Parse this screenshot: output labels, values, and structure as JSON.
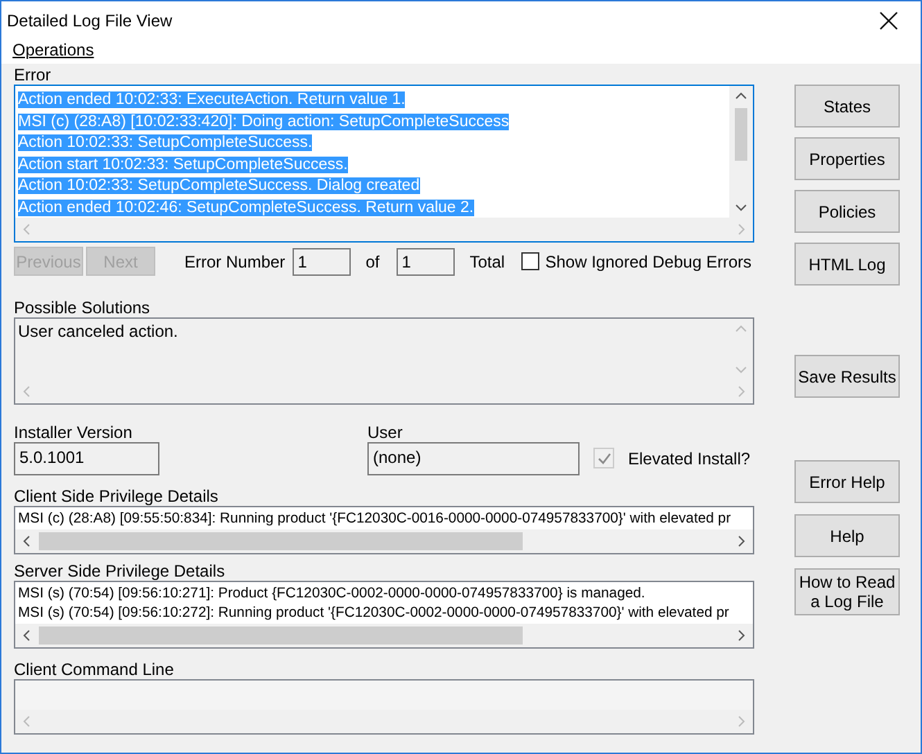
{
  "window": {
    "title": "Detailed Log File View"
  },
  "menu": [
    {
      "label": "Operations"
    }
  ],
  "error": {
    "label": "Error",
    "lines": [
      {
        "text": "Action ended 10:02:33: ExecuteAction. Return value 1.",
        "selected": true
      },
      {
        "text": "MSI (c) (28:A8) [10:02:33:420]: Doing action: SetupCompleteSuccess",
        "selected": true
      },
      {
        "text": "Action 10:02:33: SetupCompleteSuccess.",
        "selected": true
      },
      {
        "text": "Action start 10:02:33: SetupCompleteSuccess.",
        "selected": true
      },
      {
        "text": "Action 10:02:33: SetupCompleteSuccess. Dialog created",
        "selected": true
      },
      {
        "text": "Action ended 10:02:46: SetupCompleteSuccess. Return value 2.",
        "selected": true
      }
    ]
  },
  "navigation": [
    {
      "label": "Previous",
      "disabled": true
    },
    {
      "label": "Next",
      "disabled": true
    }
  ],
  "error_number": {
    "label": "Error Number",
    "value": "1",
    "of": "of",
    "total_value": "1",
    "total_label": "Total"
  },
  "show_ignored": {
    "label": "Show Ignored Debug Errors",
    "checked": false
  },
  "possible_solutions": {
    "label": "Possible Solutions",
    "text": "User canceled action."
  },
  "installer_version": {
    "label": "Installer Version",
    "value": "5.0.1001"
  },
  "user": {
    "label": "User",
    "value": "(none)"
  },
  "elevated_install": {
    "label": "Elevated Install?",
    "checked": true,
    "disabled": true
  },
  "client_side": {
    "label": "Client Side Privilege Details",
    "lines": [
      "MSI (c) (28:A8) [09:55:50:834]: Running product '{FC12030C-0016-0000-0000-074957833700}' with elevated pr"
    ]
  },
  "server_side": {
    "label": "Server Side Privilege Details",
    "lines": [
      "MSI (s) (70:54) [09:56:10:271]: Product {FC12030C-0002-0000-0000-074957833700} is managed.",
      "MSI (s) (70:54) [09:56:10:272]: Running product '{FC12030C-0002-0000-0000-074957833700}' with elevated pr"
    ]
  },
  "client_command_line": {
    "label": "Client Command Line"
  },
  "buttons": [
    {
      "label": "States",
      "kind": "top"
    },
    {
      "label": "Properties",
      "kind": "top"
    },
    {
      "label": "Policies",
      "kind": "top"
    },
    {
      "label": "HTML Log",
      "kind": "top"
    },
    {
      "label": "Save Results",
      "kind": "middle"
    },
    {
      "label": "Error Help",
      "kind": "bottom"
    },
    {
      "label": "Help",
      "kind": "bottom"
    },
    {
      "label": "How to Read a Log File",
      "kind": "bottom"
    }
  ]
}
